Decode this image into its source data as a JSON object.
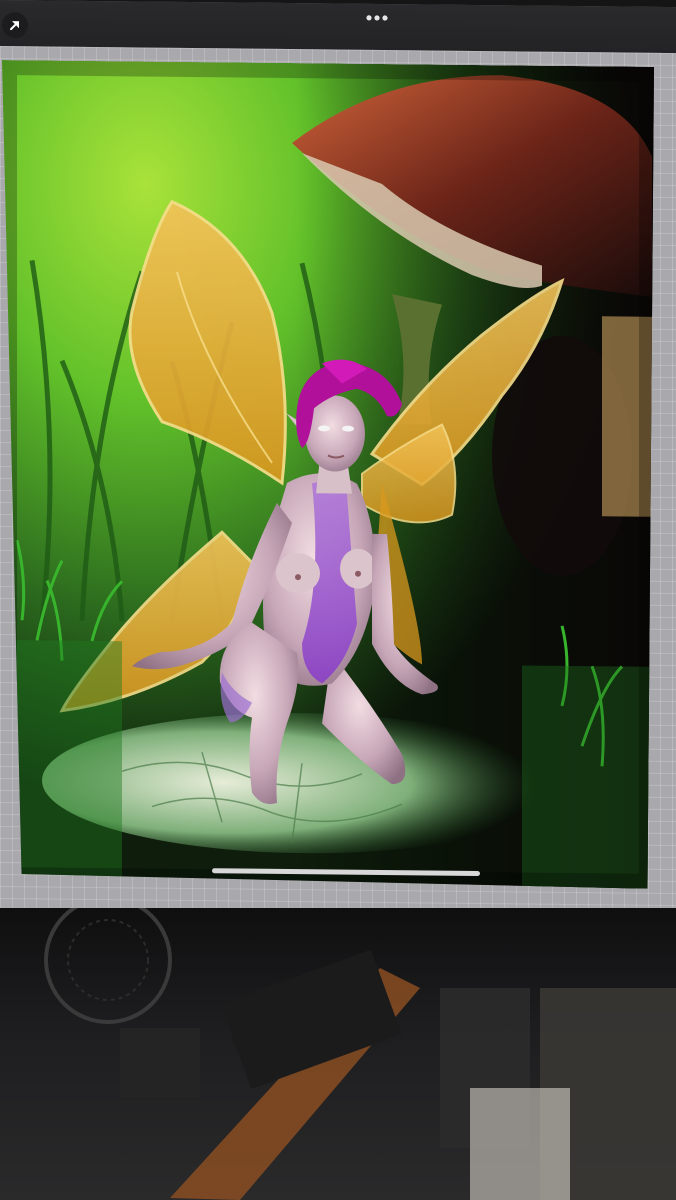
{
  "toolbar": {
    "back_icon": "arrow-up-left-icon",
    "menu_icon": "ellipsis-icon"
  },
  "artwork": {
    "subject": "fairy-illustration"
  },
  "colors": {
    "toolbar_bg": "#2a2a2c",
    "canvas_grid": "#a9a9ad",
    "hair": "#b0109a",
    "wings": "#e8b23a",
    "grass": "#2faa2f",
    "background_glow": "#9fd22a"
  }
}
